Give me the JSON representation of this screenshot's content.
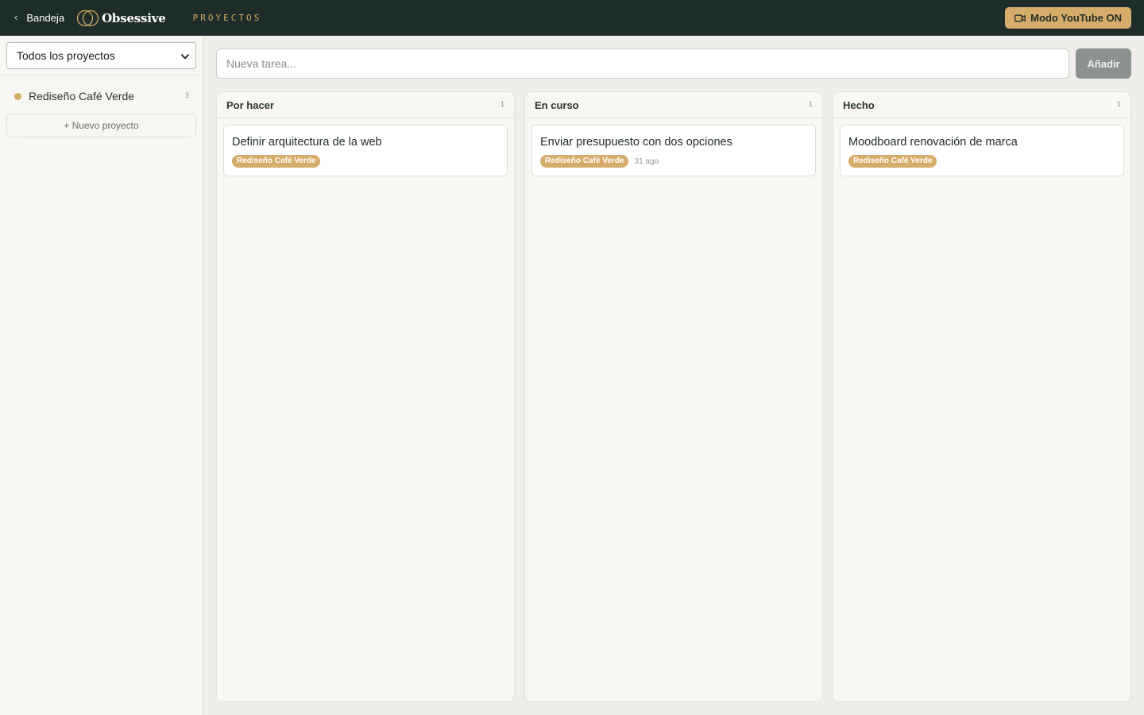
{
  "topbar": {
    "back_label": "Bandeja",
    "brand_name": "Obsessive",
    "section": "PROYECTOS",
    "youtube_button": "Modo YouTube ON"
  },
  "sidebar": {
    "filter_selected": "Todos los proyectos",
    "projects": [
      {
        "name": "Rediseño Café Verde",
        "count": "3",
        "color": "#d4a962"
      }
    ],
    "new_project_label": "+ Nuevo proyecto"
  },
  "composer": {
    "placeholder": "Nueva tarea...",
    "add_label": "Añadir"
  },
  "board": {
    "columns": [
      {
        "title": "Por hacer",
        "count": "1",
        "cards": [
          {
            "title": "Definir arquitectura de la web",
            "tag": "Rediseño Café Verde",
            "date": ""
          }
        ]
      },
      {
        "title": "En curso",
        "count": "1",
        "cards": [
          {
            "title": "Enviar presupuesto con dos opciones",
            "tag": "Rediseño Café Verde",
            "date": "31 ago"
          }
        ]
      },
      {
        "title": "Hecho",
        "count": "1",
        "cards": [
          {
            "title": "Moodboard renovación de marca",
            "tag": "Rediseño Café Verde",
            "date": ""
          }
        ]
      }
    ]
  },
  "colors": {
    "topbar_bg": "#1f2d2a",
    "accent": "#d6ac6a",
    "button_disabled": "#8a918e"
  }
}
